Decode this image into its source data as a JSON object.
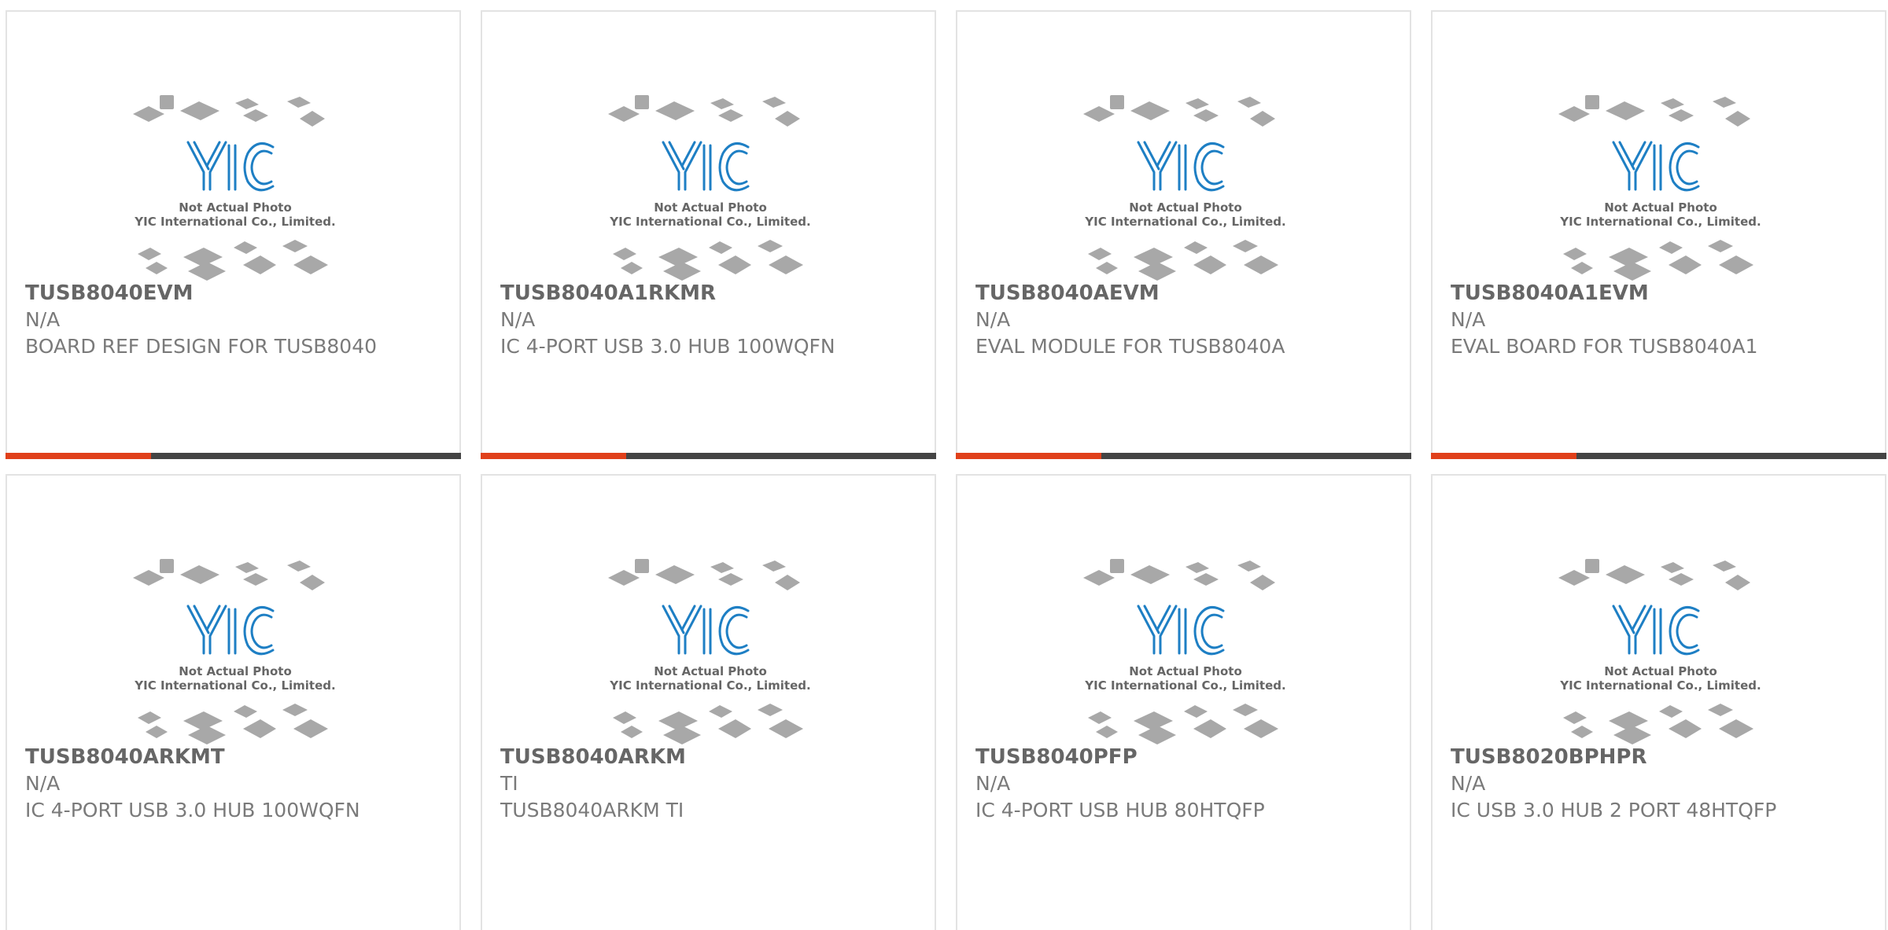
{
  "placeholder": {
    "line1": "Not Actual Photo",
    "line2": "YIC International Co., Limited.",
    "logo_text": "YIC"
  },
  "colors": {
    "accent": "#e0401a",
    "bar": "#444444",
    "logo": "#1e7fc4",
    "text": "#666666",
    "chips": "#a8a8a8"
  },
  "products": [
    {
      "part": "TUSB8040EVM",
      "manufacturer": "N/A",
      "description": "BOARD REF DESIGN FOR TUSB8040"
    },
    {
      "part": "TUSB8040A1RKMR",
      "manufacturer": "N/A",
      "description": "IC 4-PORT USB 3.0 HUB 100WQFN"
    },
    {
      "part": "TUSB8040AEVM",
      "manufacturer": "N/A",
      "description": "EVAL MODULE FOR TUSB8040A"
    },
    {
      "part": "TUSB8040A1EVM",
      "manufacturer": "N/A",
      "description": "EVAL BOARD FOR TUSB8040A1"
    },
    {
      "part": "TUSB8040ARKMT",
      "manufacturer": "N/A",
      "description": "IC 4-PORT USB 3.0 HUB 100WQFN"
    },
    {
      "part": "TUSB8040ARKM",
      "manufacturer": "TI",
      "description": "TUSB8040ARKM TI"
    },
    {
      "part": "TUSB8040PFP",
      "manufacturer": "N/A",
      "description": "IC 4-PORT USB HUB 80HTQFP"
    },
    {
      "part": "TUSB8020BPHPR",
      "manufacturer": "N/A",
      "description": "IC USB 3.0 HUB 2 PORT 48HTQFP"
    }
  ]
}
